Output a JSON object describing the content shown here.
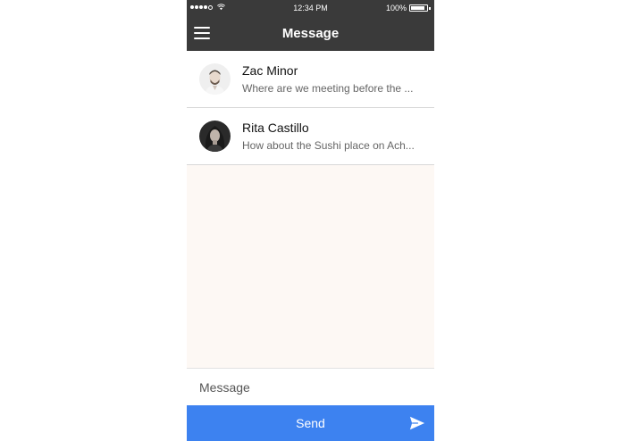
{
  "status_bar": {
    "time": "12:34 PM",
    "battery": "100%",
    "battery_level": 1.0,
    "signal_bars": 4
  },
  "nav": {
    "title": "Message",
    "menu_icon": "hamburger-menu-icon"
  },
  "conversations": [
    {
      "name": "Zac Minor",
      "preview": "Where are we meeting before the ..."
    },
    {
      "name": "Rita Castillo",
      "preview": "How about the Sushi place on Ach..."
    }
  ],
  "composer": {
    "placeholder": "Message",
    "send_label": "Send",
    "send_icon": "paper-plane-icon"
  },
  "colors": {
    "nav_background": "#3a3a3a",
    "accent": "#3d82f0",
    "thread_background": "#fdf8f4"
  }
}
